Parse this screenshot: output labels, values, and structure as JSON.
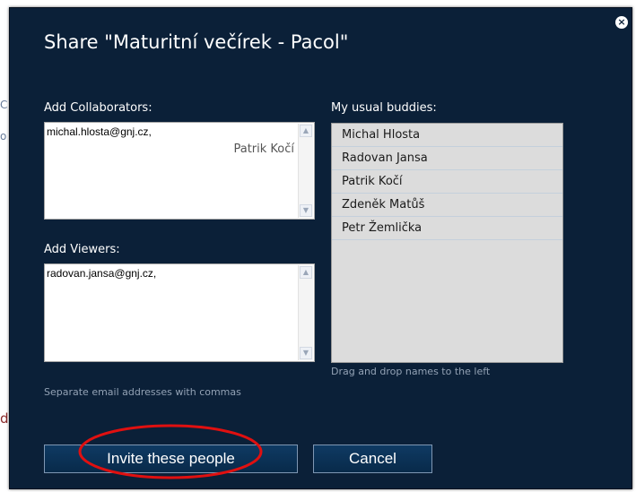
{
  "background": {
    "fragments": [
      "C",
      "o",
      "d"
    ]
  },
  "dialog": {
    "title": "Share \"Maturitní večírek - Pacol\"",
    "close_icon": "×"
  },
  "collaborators": {
    "label": "Add Collaborators:",
    "value": "michal.hlosta@gnj.cz,",
    "pending_name": "Patrik Kočí"
  },
  "viewers": {
    "label": "Add Viewers:",
    "value": "radovan.jansa@gnj.cz,"
  },
  "buddies": {
    "label": "My usual buddies:",
    "items": [
      "Michal Hlosta",
      "Radovan Jansa",
      "Patrik Kočí",
      "Zdeněk Matůš",
      "Petr Žemlička"
    ],
    "drag_hint": "Drag and drop names to the left"
  },
  "separator_hint": "Separate email addresses with commas",
  "buttons": {
    "invite": "Invite these people",
    "cancel": "Cancel"
  },
  "annotation": {
    "highlight_color": "#e01010"
  }
}
